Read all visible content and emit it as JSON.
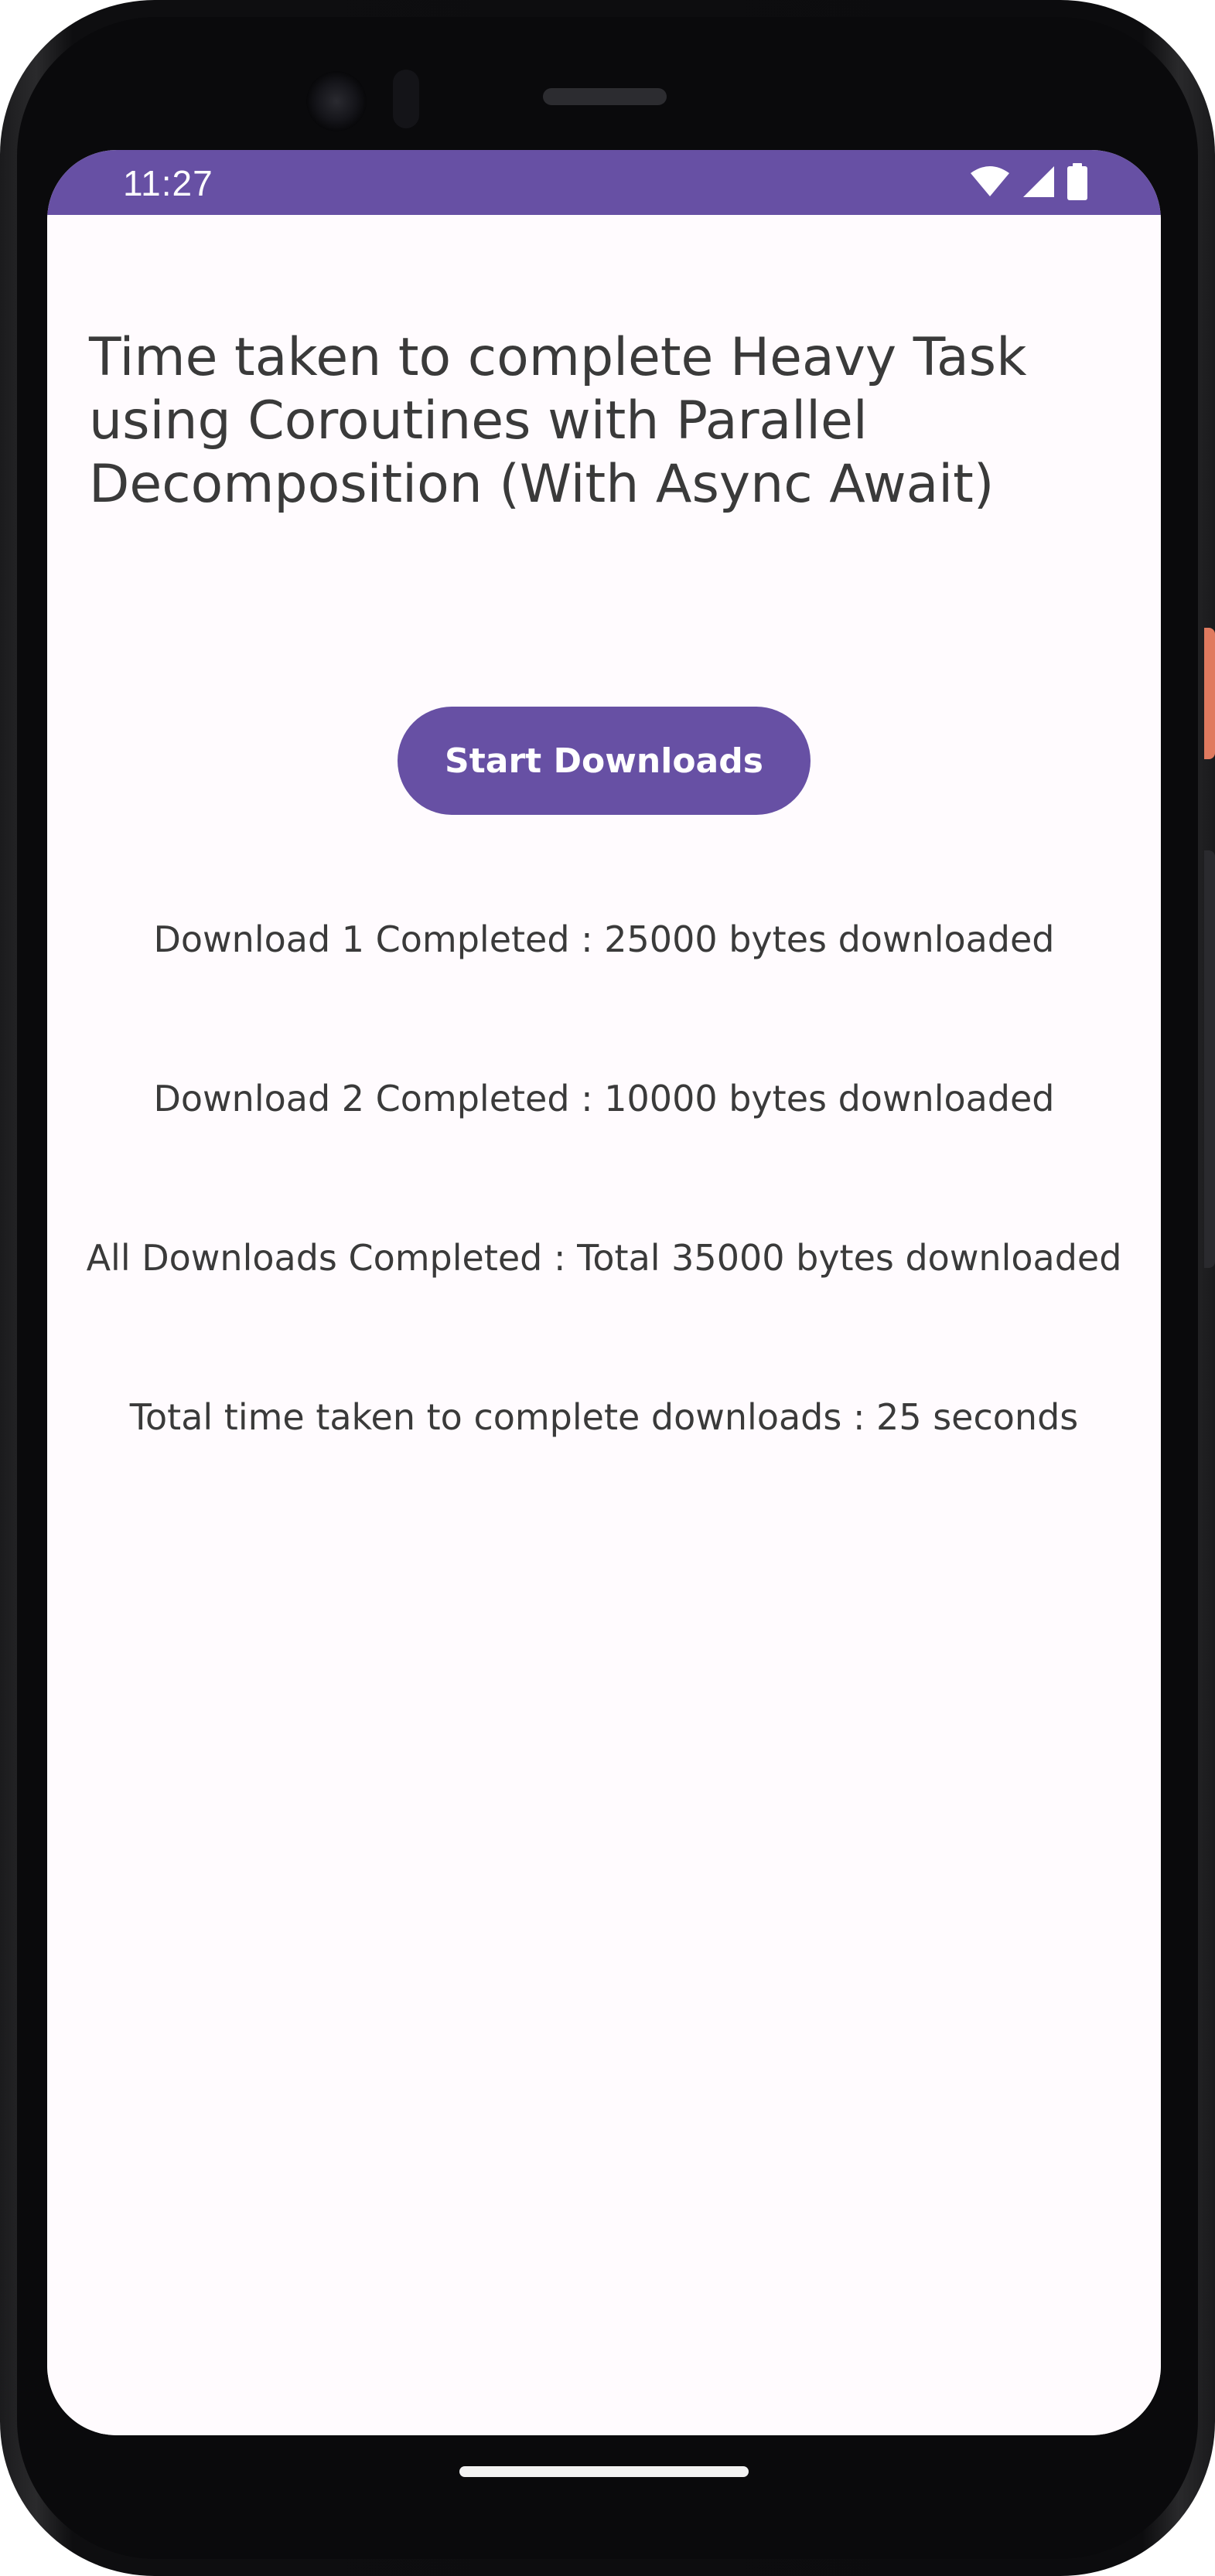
{
  "status_bar": {
    "time": "11:27",
    "icons": [
      "wifi-icon",
      "cellular-signal-icon",
      "battery-icon"
    ],
    "background_color": "#6750a4"
  },
  "screen": {
    "title": "Time taken to complete Heavy Task using Coroutines with Parallel Decomposition (With Async Await)",
    "start_button_label": "Start Downloads",
    "results": [
      "Download 1 Completed : 25000 bytes downloaded",
      "Download 2 Completed : 10000 bytes downloaded",
      "All Downloads Completed : Total 35000 bytes downloaded",
      "Total time taken to complete downloads : 25 seconds"
    ]
  },
  "colors": {
    "accent": "#6750a4",
    "background": "#fffbfe",
    "text": "#3a3a3a"
  }
}
